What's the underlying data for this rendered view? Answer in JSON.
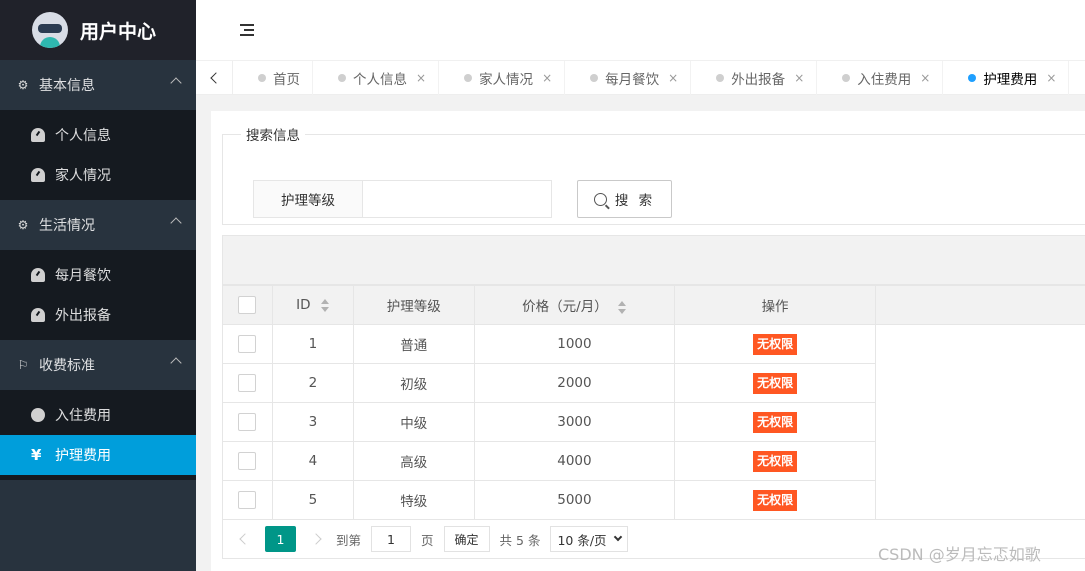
{
  "app": {
    "title": "用户中心"
  },
  "sidebar": {
    "groups": [
      {
        "label": "基本信息",
        "items": [
          {
            "label": "个人信息"
          },
          {
            "label": "家人情况"
          }
        ]
      },
      {
        "label": "生活情况",
        "items": [
          {
            "label": "每月餐饮"
          },
          {
            "label": "外出报备"
          }
        ]
      },
      {
        "label": "收费标准",
        "items": [
          {
            "label": "入住费用"
          },
          {
            "label": "护理费用",
            "active": true
          }
        ]
      }
    ]
  },
  "tabs": [
    {
      "label": "首页"
    },
    {
      "label": "个人信息",
      "close": "×"
    },
    {
      "label": "家人情况",
      "close": "×"
    },
    {
      "label": "每月餐饮",
      "close": "×"
    },
    {
      "label": "外出报备",
      "close": "×"
    },
    {
      "label": "入住费用",
      "close": "×"
    },
    {
      "label": "护理费用",
      "close": "×",
      "active": true
    }
  ],
  "search": {
    "legend": "搜索信息",
    "label": "护理等级",
    "value": "",
    "button": "搜 索"
  },
  "table": {
    "headers": {
      "id": "ID",
      "level": "护理等级",
      "price": "价格（元/月）",
      "action": "操作"
    },
    "rows": [
      {
        "id": "1",
        "level": "普通",
        "price": "1000",
        "action": "无权限"
      },
      {
        "id": "2",
        "level": "初级",
        "price": "2000",
        "action": "无权限"
      },
      {
        "id": "3",
        "level": "中级",
        "price": "3000",
        "action": "无权限"
      },
      {
        "id": "4",
        "level": "高级",
        "price": "4000",
        "action": "无权限"
      },
      {
        "id": "5",
        "level": "特级",
        "price": "5000",
        "action": "无权限"
      }
    ]
  },
  "pagination": {
    "current": "1",
    "goto_prefix": "到第",
    "goto_value": "1",
    "goto_suffix": "页",
    "confirm": "确定",
    "total": "共 5 条",
    "page_size": "10 条/页"
  },
  "watermark": "CSDN @岁月忘忑如歌",
  "colors": {
    "sidebar": "#28333e",
    "active_item": "#009edb",
    "primary": "#009688",
    "danger_badge": "#ff5722",
    "active_tab_dot": "#1e9fff"
  }
}
